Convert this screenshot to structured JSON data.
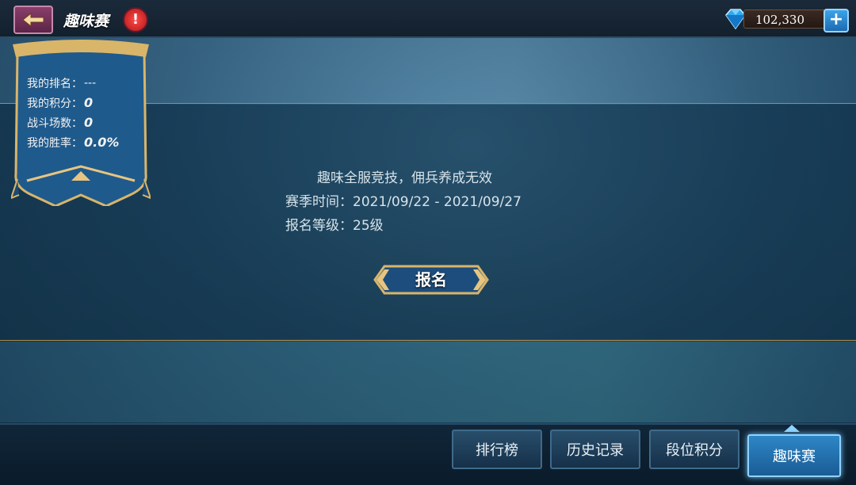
{
  "header": {
    "title": "趣味赛",
    "alert_symbol": "!",
    "gems": "102,330",
    "add_symbol": "+"
  },
  "stats": [
    {
      "label": "我的排名：",
      "value": "---"
    },
    {
      "label": "我的积分：",
      "value": "0"
    },
    {
      "label": "战斗场数：",
      "value": "0"
    },
    {
      "label": "我的胜率：",
      "value": "0.0%"
    }
  ],
  "info": {
    "line1": "趣味全服竞技，佣兵养成无效",
    "line2": "赛季时间：2021/09/22 - 2021/09/27",
    "line3": "报名等级：25级"
  },
  "signup_label": "报名",
  "tabs": [
    {
      "label": "排行榜",
      "active": false
    },
    {
      "label": "历史记录",
      "active": false
    },
    {
      "label": "段位积分",
      "active": false
    },
    {
      "label": "趣味赛",
      "active": true
    }
  ],
  "colors": {
    "accent_gold": "#c9a24a",
    "tab_active": "#2e86c6",
    "alert_red": "#d82020"
  }
}
